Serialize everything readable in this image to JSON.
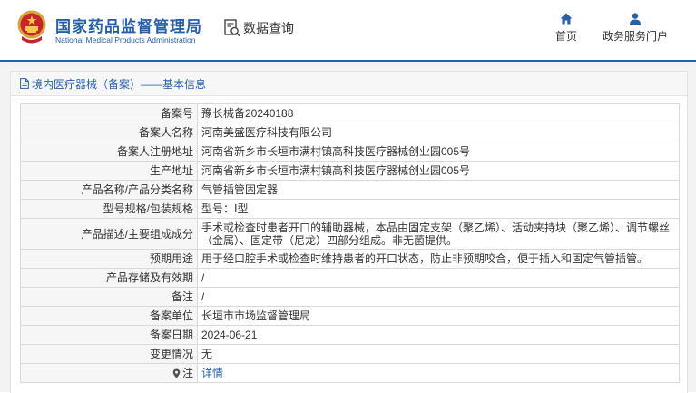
{
  "header": {
    "agency_name_cn": "国家药品监督管理局",
    "agency_name_en": "National Medical Products Administration",
    "emblem_icon": "national-emblem-icon",
    "data_query_label": "数据查询",
    "nav": [
      {
        "label": "首页",
        "icon": "home-icon"
      },
      {
        "label": "政务服务门户",
        "icon": "user-icon"
      }
    ],
    "accent_color": "#2860a8"
  },
  "panel": {
    "title": "境内医疗器械（备案）——基本信息",
    "title_icon": "document-icon"
  },
  "record": [
    {
      "label": "备案号",
      "value": "豫长械备20240188"
    },
    {
      "label": "备案人名称",
      "value": "河南美盛医疗科技有限公司"
    },
    {
      "label": "备案人注册地址",
      "value": "河南省新乡市长垣市满村镇高科技医疗器械创业园005号"
    },
    {
      "label": "生产地址",
      "value": "河南省新乡市长垣市满村镇高科技医疗器械创业园005号"
    },
    {
      "label": "产品名称/产品分类名称",
      "value": "气管插管固定器"
    },
    {
      "label": "型号规格/包装规格",
      "value": "型号：Ⅰ型"
    },
    {
      "label": "产品描述/主要组成成分",
      "value": "手术或检查时患者开口的辅助器械，本品由固定支架（聚乙烯）、活动夹持块（聚乙烯）、调节螺丝（金属）、固定带（尼龙）四部分组成。非无菌提供。"
    },
    {
      "label": "预期用途",
      "value": "用于经口腔手术或检查时维持患者的开口状态，防止非预期咬合，便于插入和固定气管插管。"
    },
    {
      "label": "产品存储及有效期",
      "value": "/"
    },
    {
      "label": "备注",
      "value": "/"
    },
    {
      "label": "备案单位",
      "value": "长垣市市场监督管理局"
    },
    {
      "label": "备案日期",
      "value": "2024-06-21"
    },
    {
      "label": "变更情况",
      "value": "无"
    },
    {
      "label": "注",
      "value": "详情",
      "icon": "location-pin-icon"
    }
  ]
}
